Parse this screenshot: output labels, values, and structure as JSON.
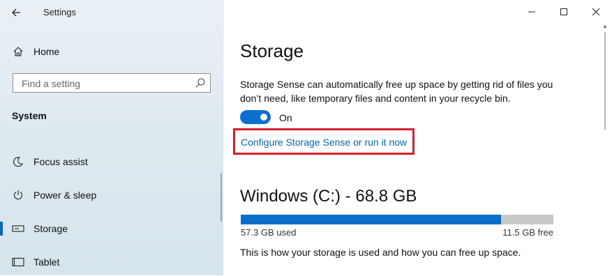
{
  "window": {
    "title": "Settings"
  },
  "sidebar": {
    "home_label": "Home",
    "search_placeholder": "Find a setting",
    "section": "System",
    "items": [
      {
        "label": "Focus assist",
        "icon": "moon-icon"
      },
      {
        "label": "Power & sleep",
        "icon": "power-icon"
      },
      {
        "label": "Storage",
        "icon": "storage-icon",
        "active": true
      },
      {
        "label": "Tablet",
        "icon": "tablet-icon"
      }
    ]
  },
  "main": {
    "title": "Storage",
    "description": "Storage Sense can automatically free up space by getting rid of files you don’t need, like temporary files and content in your recycle bin.",
    "toggle_label": "On",
    "toggle_state": true,
    "configure_link": "Configure Storage Sense or run it now",
    "drive": {
      "title": "Windows (C:) - 68.8 GB",
      "used_label": "57.3 GB used",
      "free_label": "11.5 GB free",
      "used_fraction": 0.833
    },
    "usage_description": "This is how your storage is used and how you can free up space."
  },
  "colors": {
    "accent": "#0a6fd0",
    "highlight": "#d61f2c",
    "link": "#0066b4"
  }
}
